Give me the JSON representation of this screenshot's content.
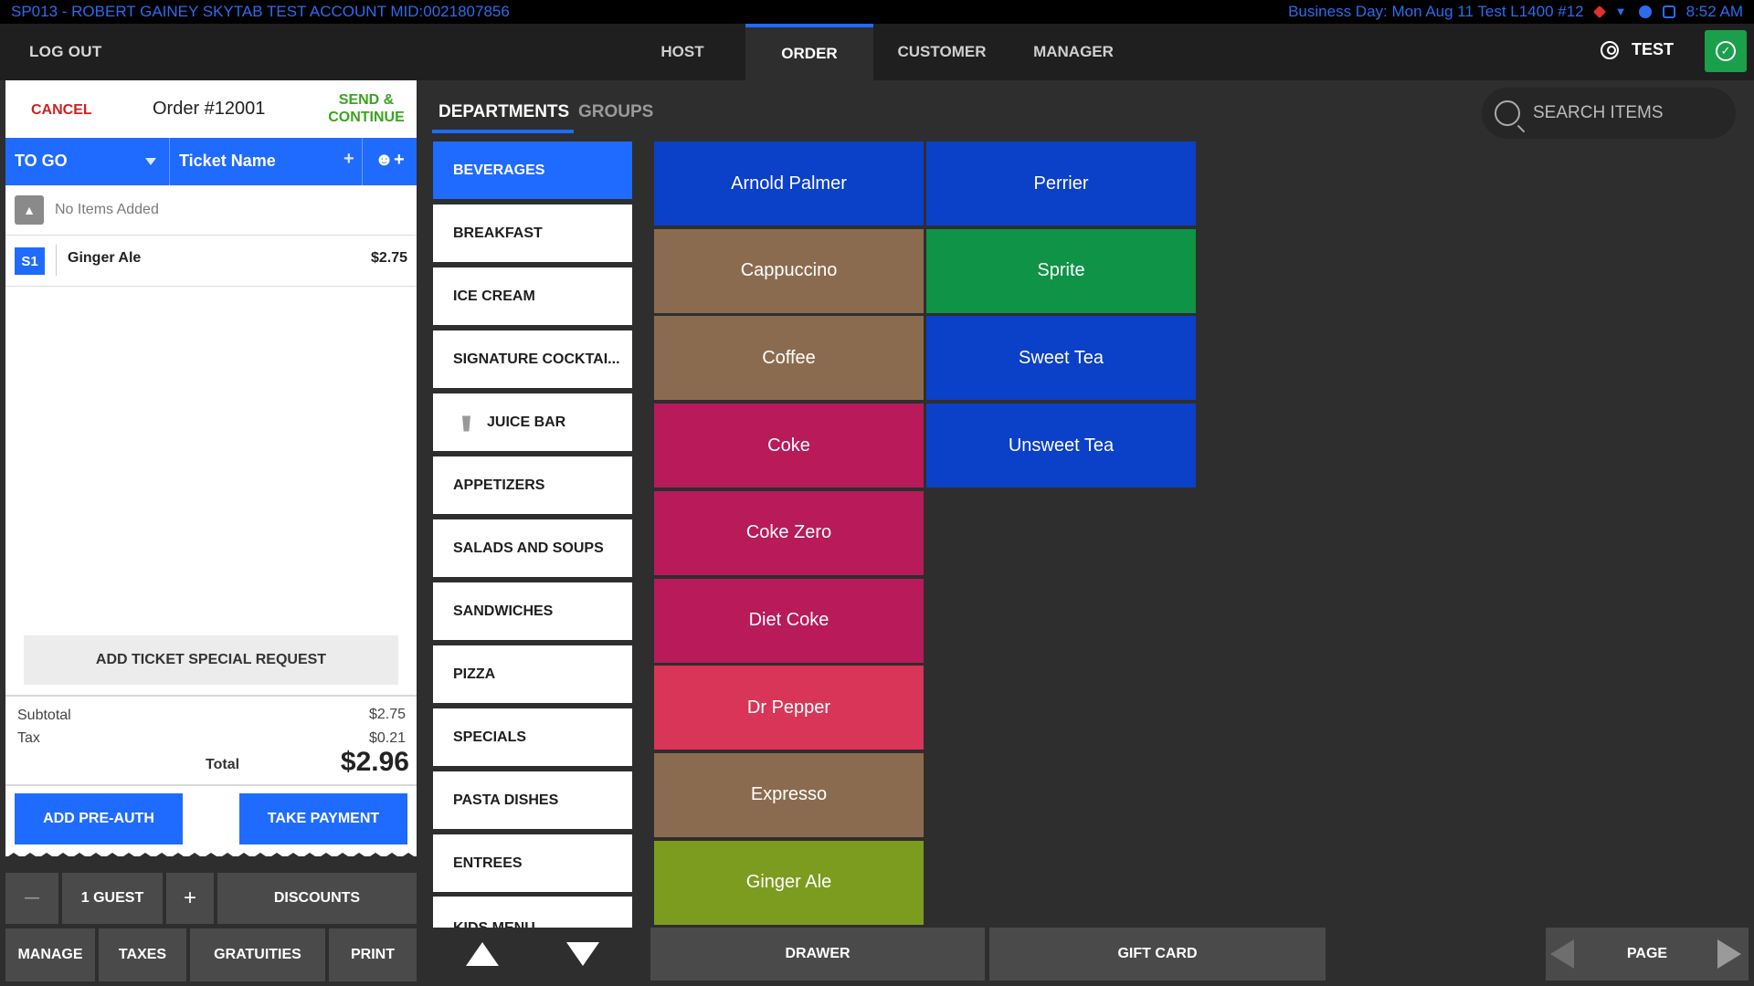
{
  "status_bar": {
    "account": "SP013 - ROBERT GAINEY SKYTAB TEST ACCOUNT   MID:0021807856",
    "business_day": "Business Day: Mon Aug 11  Test L1400  #12",
    "time": "8:52 AM"
  },
  "nav": {
    "logout": "LOG OUT",
    "tabs": [
      "HOST",
      "ORDER",
      "CUSTOMER",
      "MANAGER"
    ],
    "active_tab": "ORDER",
    "user": "TEST"
  },
  "ticket": {
    "cancel": "CANCEL",
    "order_title": "Order #12001",
    "send_line1": "SEND &",
    "send_line2": "CONTINUE",
    "order_type": "TO GO",
    "ticket_name": "Ticket Name",
    "plus": "+",
    "no_items": "No Items Added",
    "items": [
      {
        "seat": "S1",
        "name": "Ginger Ale",
        "price": "$2.75"
      }
    ],
    "special_request": "ADD TICKET SPECIAL REQUEST",
    "subtotal_label": "Subtotal",
    "subtotal": "$2.75",
    "tax_label": "Tax",
    "tax": "$0.21",
    "total_label": "Total",
    "total": "$2.96",
    "add_preauth": "ADD PRE-AUTH",
    "take_payment": "TAKE PAYMENT"
  },
  "ticket_actions": {
    "minus": "—",
    "guests": "1 GUEST",
    "plus": "+",
    "discounts": "DISCOUNTS",
    "manage": "MANAGE",
    "taxes": "TAXES",
    "gratuities": "GRATUITIES",
    "print": "PRINT"
  },
  "departments": {
    "tab_departments": "DEPARTMENTS",
    "tab_groups": "GROUPS",
    "items": [
      "BEVERAGES",
      "BREAKFAST",
      "ICE CREAM",
      "SIGNATURE COCKTAI...",
      "JUICE BAR",
      "APPETIZERS",
      "SALADS AND SOUPS",
      "SANDWICHES",
      "PIZZA",
      "SPECIALS",
      "PASTA DISHES",
      "ENTREES",
      "KIDS MENU"
    ],
    "active": "BEVERAGES"
  },
  "menu_items": {
    "col1": [
      {
        "name": "Arnold Palmer",
        "color": "#0b40c8"
      },
      {
        "name": "Cappuccino",
        "color": "#8b6b4f"
      },
      {
        "name": "Coffee",
        "color": "#8b6b4f"
      },
      {
        "name": "Coke",
        "color": "#b81a5a"
      },
      {
        "name": "Coke Zero",
        "color": "#b81a5a"
      },
      {
        "name": "Diet Coke",
        "color": "#b81a5a"
      },
      {
        "name": "Dr Pepper",
        "color": "#d83558"
      },
      {
        "name": "Expresso",
        "color": "#8b6b4f"
      },
      {
        "name": "Ginger Ale",
        "color": "#7c9c1f"
      }
    ],
    "col2": [
      {
        "name": "Perrier",
        "color": "#0b40c8"
      },
      {
        "name": "Sprite",
        "color": "#0e9347"
      },
      {
        "name": "Sweet Tea",
        "color": "#0b40c8"
      },
      {
        "name": "Unsweet Tea",
        "color": "#0b40c8"
      }
    ]
  },
  "search": {
    "placeholder": "SEARCH ITEMS"
  },
  "bottom_bar": {
    "drawer": "DRAWER",
    "gift_card": "GIFT CARD",
    "page": "PAGE"
  },
  "colors": {
    "accent_blue": "#1f6bff",
    "cancel_red": "#d02020",
    "send_green": "#39a51e",
    "check_green": "#1aa04a"
  }
}
